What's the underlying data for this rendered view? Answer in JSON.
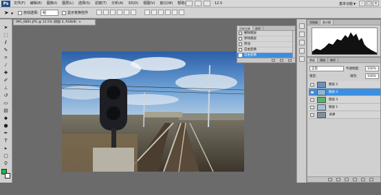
{
  "menubar": {
    "logo": "Ps",
    "items": [
      "文件(F)",
      "编辑(E)",
      "图像(I)",
      "图层(L)",
      "选择(S)",
      "滤镜(T)",
      "分析(A)",
      "3D(D)",
      "视图(V)",
      "窗口(W)",
      "帮助(H)"
    ],
    "zoom": "12.5",
    "workspace": "基本功能",
    "win_min": "–",
    "win_max": "□",
    "win_close": "×"
  },
  "options": {
    "auto_select_label": "自动选择:",
    "auto_select_value": "组",
    "show_transform_label": "显示变换控件"
  },
  "document": {
    "tab_title": "IMG_6891.JPG @ 12.5% (图层 4, RGB/8)",
    "tab_close": "×"
  },
  "history_panel": {
    "tabs": [
      "历史记录",
      "动作"
    ],
    "rows": [
      "删除图层",
      "移除图层",
      "移动",
      "自由变换",
      "自由变换"
    ],
    "selected_index": 4
  },
  "navigator_panel": {
    "tabs": [
      "导航器",
      "直方图"
    ]
  },
  "layers_panel": {
    "tabs": [
      "图层",
      "通道",
      "路径"
    ],
    "blend_mode": "正常",
    "opacity_label": "不透明度:",
    "opacity_value": "100%",
    "lock_label": "锁定:",
    "fill_label": "填充:",
    "fill_value": "100%",
    "layers": [
      {
        "name": "图层 2",
        "selected": false
      },
      {
        "name": "图层 4",
        "selected": true
      },
      {
        "name": "图层 3",
        "selected": false
      },
      {
        "name": "图层 1",
        "selected": false
      },
      {
        "name": "背景",
        "selected": false
      }
    ]
  },
  "colors": {
    "foreground": "#1db84a",
    "background": "#ffffff",
    "selection": "#3c8fe0"
  }
}
